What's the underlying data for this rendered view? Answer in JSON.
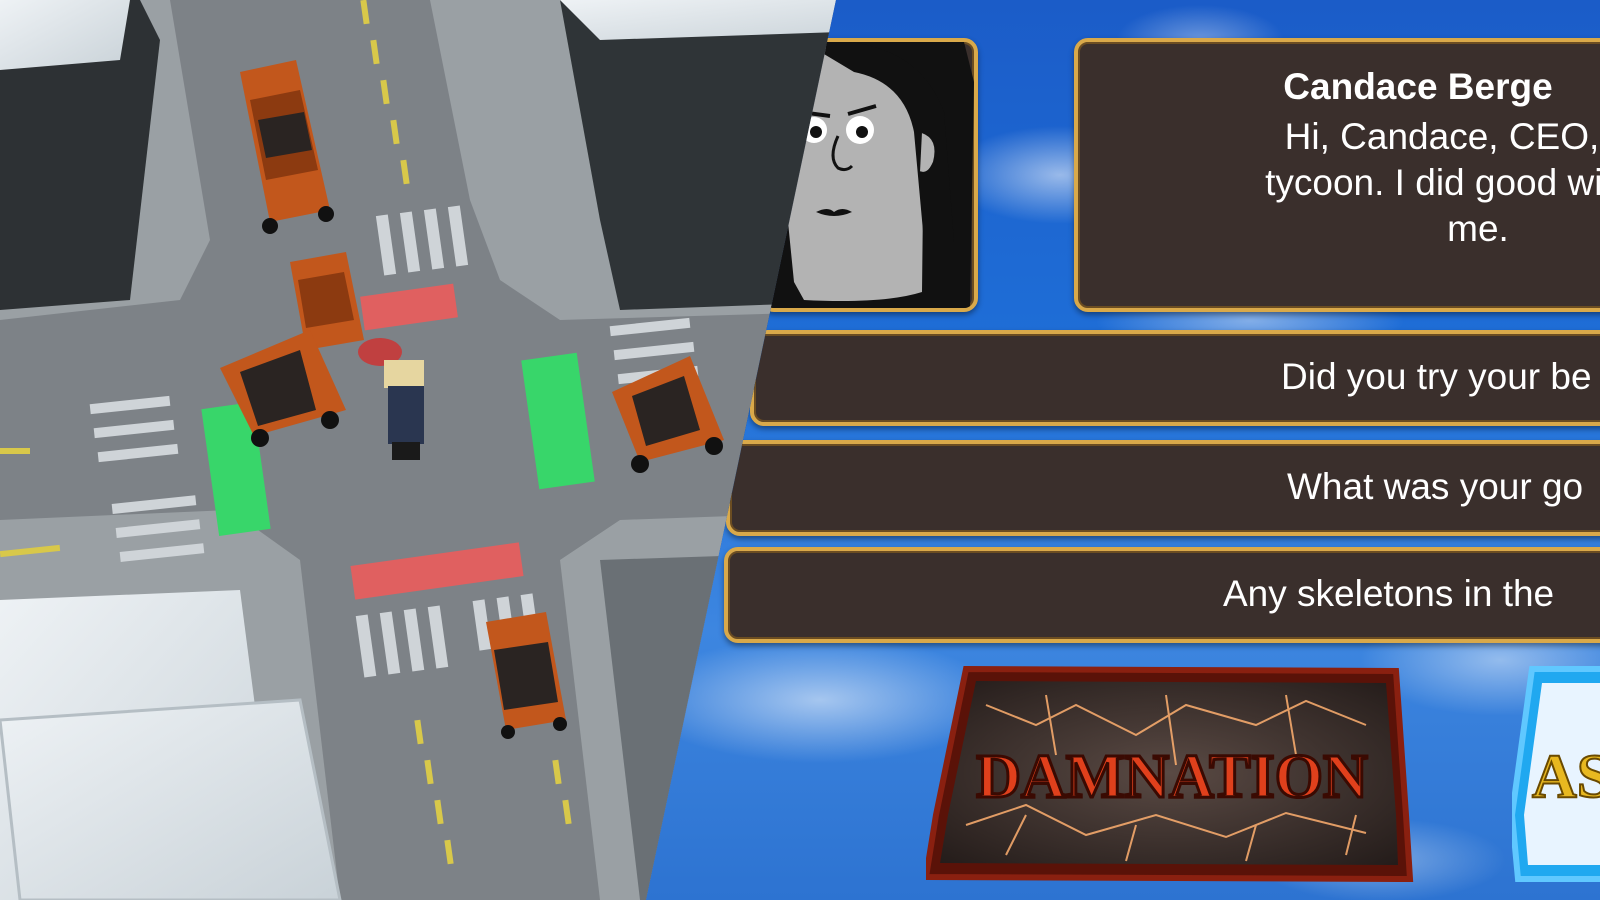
{
  "scene": {
    "left_view": "traffic-intersection",
    "right_view": "afterlife-interview"
  },
  "dialog": {
    "speaker_name": "Candace Berge",
    "speaker_line": "Hi, Candace, CEO, and tycoon. I did good with what was given to me.",
    "speaker_line_lines": [
      "Hi, Candace, CEO, and",
      "tycoon. I did good with wh",
      "me."
    ]
  },
  "options": [
    {
      "label": "Did you try your be"
    },
    {
      "label": "What was your go"
    },
    {
      "label": "Any skeletons in the "
    }
  ],
  "judgement": {
    "damnation_label": "DAMNATION",
    "ascension_label": "AS"
  },
  "colors": {
    "panel_bg": "#3a2f2c",
    "panel_border": "#d9a94a",
    "car_body": "#c2571c",
    "go_signal": "#38d66a",
    "stop_signal": "#e06060",
    "damnation_text": "#e0401c",
    "ascension_text": "#e8b820"
  }
}
